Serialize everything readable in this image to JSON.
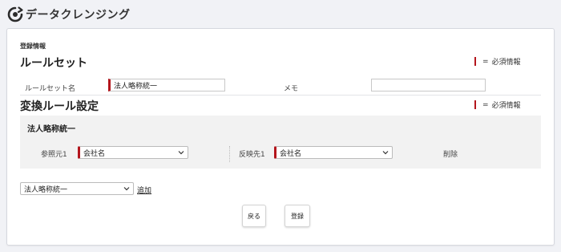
{
  "app": {
    "title": "データクレンジング",
    "logo_icon": "cleansing-logo-icon"
  },
  "form": {
    "section_caption": "登録情報",
    "ruleset_heading": "ルールセット",
    "required_note": {
      "symbol": "=",
      "text": "必須情報"
    },
    "ruleset_name_label": "ルールセット名",
    "ruleset_name_value": "法人略称統一",
    "memo_label": "メモ",
    "memo_value": "",
    "transform_heading": "変換ルール設定",
    "transform_required_note": {
      "symbol": "=",
      "text": "必須情報"
    }
  },
  "rule": {
    "title": "法人略称統一",
    "source_label": "参照元1",
    "source_value": "会社名",
    "target_label": "反映先1",
    "target_value": "会社名",
    "delete_label": "削除"
  },
  "add_rule": {
    "select_value": "法人略称統一",
    "add_label": "追加"
  },
  "buttons": {
    "back_label": "戻る",
    "register_label": "登録"
  },
  "colors": {
    "required_accent": "#b4151c",
    "page_bg": "#f1f2f6",
    "rule_block_bg": "#f2f2f2"
  }
}
